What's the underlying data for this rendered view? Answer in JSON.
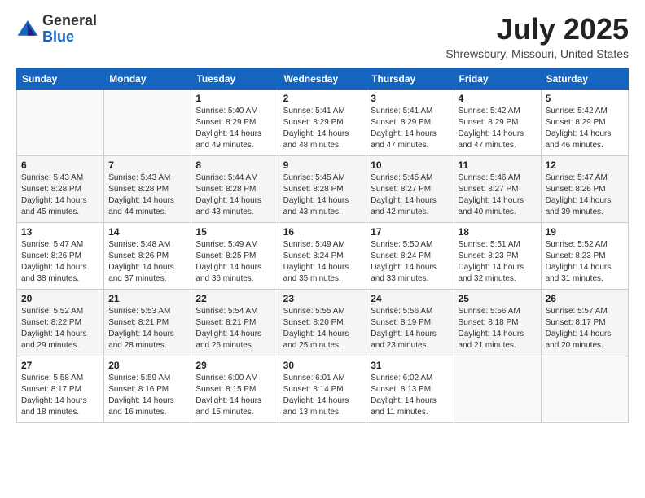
{
  "header": {
    "logo_line1": "General",
    "logo_line2": "Blue",
    "month_year": "July 2025",
    "location": "Shrewsbury, Missouri, United States"
  },
  "weekdays": [
    "Sunday",
    "Monday",
    "Tuesday",
    "Wednesday",
    "Thursday",
    "Friday",
    "Saturday"
  ],
  "weeks": [
    [
      {
        "day": "",
        "info": ""
      },
      {
        "day": "",
        "info": ""
      },
      {
        "day": "1",
        "info": "Sunrise: 5:40 AM\nSunset: 8:29 PM\nDaylight: 14 hours and 49 minutes."
      },
      {
        "day": "2",
        "info": "Sunrise: 5:41 AM\nSunset: 8:29 PM\nDaylight: 14 hours and 48 minutes."
      },
      {
        "day": "3",
        "info": "Sunrise: 5:41 AM\nSunset: 8:29 PM\nDaylight: 14 hours and 47 minutes."
      },
      {
        "day": "4",
        "info": "Sunrise: 5:42 AM\nSunset: 8:29 PM\nDaylight: 14 hours and 47 minutes."
      },
      {
        "day": "5",
        "info": "Sunrise: 5:42 AM\nSunset: 8:29 PM\nDaylight: 14 hours and 46 minutes."
      }
    ],
    [
      {
        "day": "6",
        "info": "Sunrise: 5:43 AM\nSunset: 8:28 PM\nDaylight: 14 hours and 45 minutes."
      },
      {
        "day": "7",
        "info": "Sunrise: 5:43 AM\nSunset: 8:28 PM\nDaylight: 14 hours and 44 minutes."
      },
      {
        "day": "8",
        "info": "Sunrise: 5:44 AM\nSunset: 8:28 PM\nDaylight: 14 hours and 43 minutes."
      },
      {
        "day": "9",
        "info": "Sunrise: 5:45 AM\nSunset: 8:28 PM\nDaylight: 14 hours and 43 minutes."
      },
      {
        "day": "10",
        "info": "Sunrise: 5:45 AM\nSunset: 8:27 PM\nDaylight: 14 hours and 42 minutes."
      },
      {
        "day": "11",
        "info": "Sunrise: 5:46 AM\nSunset: 8:27 PM\nDaylight: 14 hours and 40 minutes."
      },
      {
        "day": "12",
        "info": "Sunrise: 5:47 AM\nSunset: 8:26 PM\nDaylight: 14 hours and 39 minutes."
      }
    ],
    [
      {
        "day": "13",
        "info": "Sunrise: 5:47 AM\nSunset: 8:26 PM\nDaylight: 14 hours and 38 minutes."
      },
      {
        "day": "14",
        "info": "Sunrise: 5:48 AM\nSunset: 8:26 PM\nDaylight: 14 hours and 37 minutes."
      },
      {
        "day": "15",
        "info": "Sunrise: 5:49 AM\nSunset: 8:25 PM\nDaylight: 14 hours and 36 minutes."
      },
      {
        "day": "16",
        "info": "Sunrise: 5:49 AM\nSunset: 8:24 PM\nDaylight: 14 hours and 35 minutes."
      },
      {
        "day": "17",
        "info": "Sunrise: 5:50 AM\nSunset: 8:24 PM\nDaylight: 14 hours and 33 minutes."
      },
      {
        "day": "18",
        "info": "Sunrise: 5:51 AM\nSunset: 8:23 PM\nDaylight: 14 hours and 32 minutes."
      },
      {
        "day": "19",
        "info": "Sunrise: 5:52 AM\nSunset: 8:23 PM\nDaylight: 14 hours and 31 minutes."
      }
    ],
    [
      {
        "day": "20",
        "info": "Sunrise: 5:52 AM\nSunset: 8:22 PM\nDaylight: 14 hours and 29 minutes."
      },
      {
        "day": "21",
        "info": "Sunrise: 5:53 AM\nSunset: 8:21 PM\nDaylight: 14 hours and 28 minutes."
      },
      {
        "day": "22",
        "info": "Sunrise: 5:54 AM\nSunset: 8:21 PM\nDaylight: 14 hours and 26 minutes."
      },
      {
        "day": "23",
        "info": "Sunrise: 5:55 AM\nSunset: 8:20 PM\nDaylight: 14 hours and 25 minutes."
      },
      {
        "day": "24",
        "info": "Sunrise: 5:56 AM\nSunset: 8:19 PM\nDaylight: 14 hours and 23 minutes."
      },
      {
        "day": "25",
        "info": "Sunrise: 5:56 AM\nSunset: 8:18 PM\nDaylight: 14 hours and 21 minutes."
      },
      {
        "day": "26",
        "info": "Sunrise: 5:57 AM\nSunset: 8:17 PM\nDaylight: 14 hours and 20 minutes."
      }
    ],
    [
      {
        "day": "27",
        "info": "Sunrise: 5:58 AM\nSunset: 8:17 PM\nDaylight: 14 hours and 18 minutes."
      },
      {
        "day": "28",
        "info": "Sunrise: 5:59 AM\nSunset: 8:16 PM\nDaylight: 14 hours and 16 minutes."
      },
      {
        "day": "29",
        "info": "Sunrise: 6:00 AM\nSunset: 8:15 PM\nDaylight: 14 hours and 15 minutes."
      },
      {
        "day": "30",
        "info": "Sunrise: 6:01 AM\nSunset: 8:14 PM\nDaylight: 14 hours and 13 minutes."
      },
      {
        "day": "31",
        "info": "Sunrise: 6:02 AM\nSunset: 8:13 PM\nDaylight: 14 hours and 11 minutes."
      },
      {
        "day": "",
        "info": ""
      },
      {
        "day": "",
        "info": ""
      }
    ]
  ]
}
